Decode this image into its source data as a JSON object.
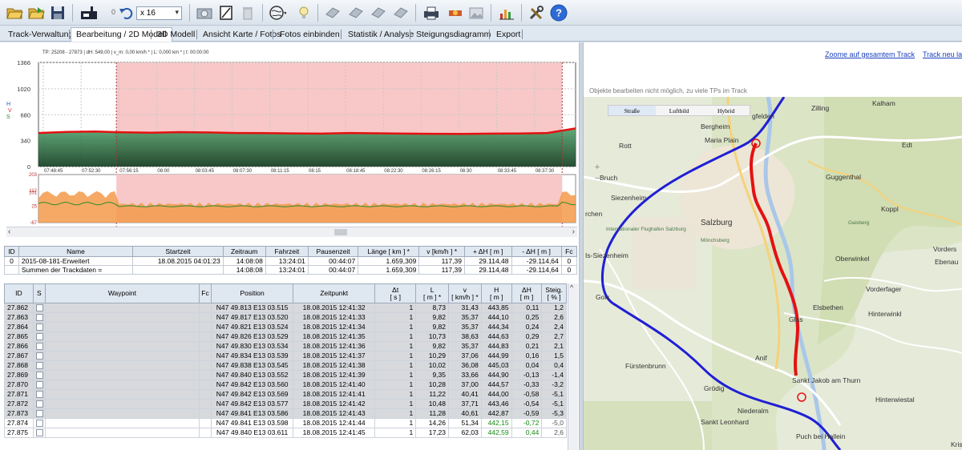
{
  "toolbar": {
    "items": [
      "open-folder-icon",
      "open-green-folder-icon",
      "save-icon",
      "device-icon",
      "undo-icon",
      "camera-icon",
      "notebook-icon",
      "bin-icon",
      "globe-icon",
      "bulb-icon",
      "gear-icon",
      "gear2-icon",
      "gear3-icon",
      "gear4-icon",
      "print-icon",
      "satellite-icon",
      "photo-icon",
      "chart-icon",
      "tools-icon",
      "help-icon"
    ],
    "zoom_value": "x 16",
    "counter": "0"
  },
  "tabs": [
    "Track-Verwaltung",
    "Bearbeitung / 2D Modell",
    "3D Modell",
    "Ansicht Karte / Fotos",
    "Fotos einbinden",
    "Statistik / Analyse",
    "Steigungsdiagramm",
    "Export"
  ],
  "active_tab": 1,
  "chart_info": "TP: 25208 - 27873 | dH: 549,00  | v_m: 0,00 km/h * | L: 0,000 km * | t: 00:00:00",
  "chart_data": [
    {
      "type": "area",
      "ylabel": "H V S",
      "yticks": [
        0,
        340,
        680,
        1020,
        1366
      ],
      "ylim": [
        0,
        1366
      ],
      "xticks": [
        "07:48:45",
        "07:52:30",
        "07:56:15",
        "08:00",
        "08:03:45",
        "08:07:30",
        "08:11:15",
        "08:15",
        "08:18:45",
        "08:22:30",
        "08:26:15",
        "08:30",
        "08:33:45",
        "08:37:30"
      ],
      "series": [
        {
          "values": [
            440,
            455,
            460,
            450,
            445,
            452,
            448,
            440,
            438,
            435,
            432,
            440,
            436,
            432,
            430,
            428,
            432,
            434,
            440,
            500
          ],
          "color": "#e31111"
        }
      ],
      "selection_color": "#f8c7c7"
    },
    {
      "type": "area",
      "yticks": [
        -67,
        25,
        101,
        112,
        203
      ],
      "ylim": [
        -67,
        203
      ],
      "series": [
        {
          "color": "#f39a4a"
        },
        {
          "color": "#2a8c2a"
        }
      ]
    }
  ],
  "summary": {
    "headers": [
      "ID",
      "Name",
      "Startzeit",
      "Zeitraum",
      "Fahrzeit",
      "Pausenzeit",
      "Länge  [ km ] *",
      "v  [km/h ] *",
      "+ ΔH  [ m ]",
      "- ΔH  [ m ]",
      "Fc"
    ],
    "rows": [
      [
        "0",
        "2015-08-181-Erweitert",
        "18.08.2015 04:01:23",
        "14:08:08",
        "13:24:01",
        "00:44:07",
        "1.659,309",
        "117,39",
        "29.114,48",
        "-29.114,64",
        "0"
      ],
      [
        "",
        "Summen der Trackdaten =",
        "",
        "14:08:08",
        "13:24:01",
        "00:44:07",
        "1.659,309",
        "117,39",
        "29.114,48",
        "-29.114,64",
        "0"
      ]
    ]
  },
  "waypoints": {
    "headers": [
      "ID",
      "S",
      "Waypoint",
      "Fc",
      "Position",
      "Zeitpunkt",
      "Δt\n[ s ]",
      "L\n[ m ] *",
      "v\n[ km/h ] *",
      "H\n[ m ]",
      "ΔH\n[ m ]",
      "Steig.\n[ % ]"
    ],
    "rows": [
      [
        "27.862",
        "N47 49.813 E13 03.515",
        "18.08.2015 12:41:32",
        "1",
        "8,73",
        "31,43",
        "443,85",
        "0,11",
        "1,2"
      ],
      [
        "27.863",
        "N47 49.817 E13 03.520",
        "18.08.2015 12:41:33",
        "1",
        "9,82",
        "35,37",
        "444,10",
        "0,25",
        "2,6"
      ],
      [
        "27.864",
        "N47 49.821 E13 03.524",
        "18.08.2015 12:41:34",
        "1",
        "9,82",
        "35,37",
        "444,34",
        "0,24",
        "2,4"
      ],
      [
        "27.865",
        "N47 49.826 E13 03.529",
        "18.08.2015 12:41:35",
        "1",
        "10,73",
        "38,63",
        "444,63",
        "0,29",
        "2,7"
      ],
      [
        "27.866",
        "N47 49.830 E13 03.534",
        "18.08.2015 12:41:36",
        "1",
        "9,82",
        "35,37",
        "444,83",
        "0,21",
        "2,1"
      ],
      [
        "27.867",
        "N47 49.834 E13 03.539",
        "18.08.2015 12:41:37",
        "1",
        "10,29",
        "37,06",
        "444,99",
        "0,16",
        "1,5"
      ],
      [
        "27.868",
        "N47 49.838 E13 03.545",
        "18.08.2015 12:41:38",
        "1",
        "10,02",
        "36,08",
        "445,03",
        "0,04",
        "0,4"
      ],
      [
        "27.869",
        "N47 49.840 E13 03.552",
        "18.08.2015 12:41:39",
        "1",
        "9,35",
        "33,66",
        "444,90",
        "-0,13",
        "-1,4"
      ],
      [
        "27.870",
        "N47 49.842 E13 03.560",
        "18.08.2015 12:41:40",
        "1",
        "10,28",
        "37,00",
        "444,57",
        "-0,33",
        "-3,2"
      ],
      [
        "27.871",
        "N47 49.842 E13 03.569",
        "18.08.2015 12:41:41",
        "1",
        "11,22",
        "40,41",
        "444,00",
        "-0,58",
        "-5,1"
      ],
      [
        "27.872",
        "N47 49.842 E13 03.577",
        "18.08.2015 12:41:42",
        "1",
        "10,48",
        "37,71",
        "443,46",
        "-0,54",
        "-5,1"
      ],
      [
        "27.873",
        "N47 49.841 E13 03.586",
        "18.08.2015 12:41:43",
        "1",
        "11,28",
        "40,61",
        "442,87",
        "-0,59",
        "-5,3"
      ],
      [
        "27.874",
        "N47 49.841 E13 03.598",
        "18.08.2015 12:41:44",
        "1",
        "14,26",
        "51,34",
        "442,15",
        "-0,72",
        "-5,0"
      ],
      [
        "27.875",
        "N47 49.840 E13 03.611",
        "18.08.2015 12:41:45",
        "1",
        "17,23",
        "62,03",
        "442,59",
        "0,44",
        "2,6"
      ]
    ]
  },
  "map": {
    "links": [
      "Zoome auf gesamtem Track",
      "Track neu lad"
    ],
    "note": "Objekte bearbeiten nicht möglich, zu viele TPs im Track",
    "map_types": [
      "Straße",
      "Luftbild",
      "Hybrid"
    ],
    "selected_type": "Straße",
    "places": [
      "gfelden",
      "Zilling",
      "Bergheim",
      "Maria Plain",
      "Edt",
      "Rott",
      "Guggenthal",
      "Koppl",
      "Bruch",
      "Siezenheim",
      "Salzburg",
      "rchen",
      "Internationaler Flughafen Salzburg",
      "Mönchsberg",
      "Vorders",
      "Ebenau",
      "Is-Siezenheim",
      "Oberwinkel",
      "Vorderfager",
      "Gois",
      "Elsbethen",
      "Glas",
      "Hinterwinkl",
      "Fürstenbrunn",
      "Anif",
      "Sankt Jakob am Thurn",
      "Grödig",
      "Hinterwiestal",
      "Niederalm",
      "Sankt Leonhard",
      "Puch bei Hallein",
      "Kris",
      "Gaisberg",
      "Kalham"
    ]
  }
}
